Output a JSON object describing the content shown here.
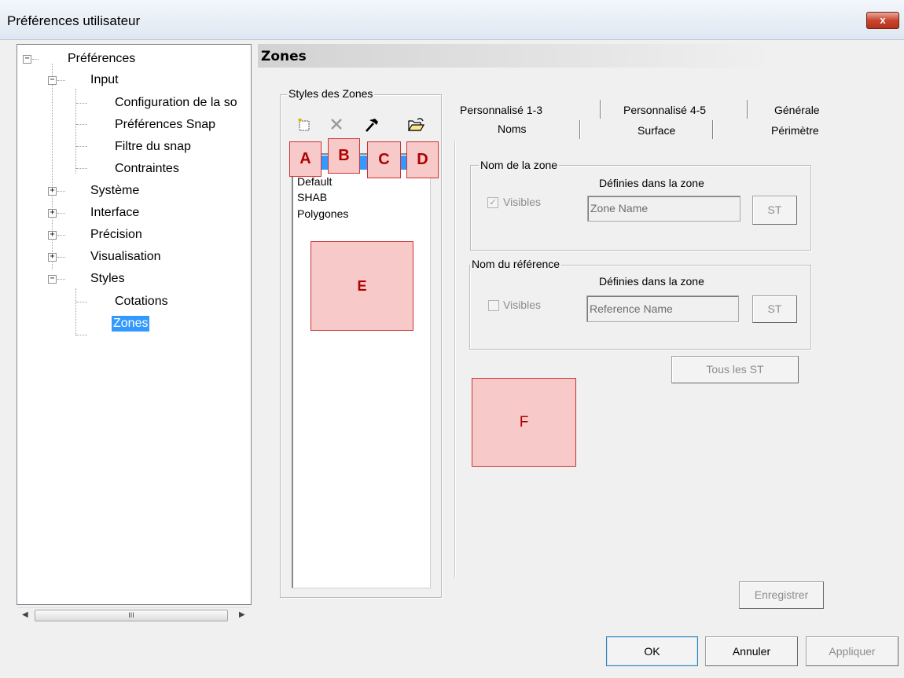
{
  "window": {
    "title": "Préférences utilisateur",
    "close_label": "x"
  },
  "tree": {
    "root": "Préférences",
    "input": "Input",
    "input_children": [
      "Configuration de la so",
      "Préférences Snap",
      "Filtre du snap",
      "Contraintes"
    ],
    "systeme": "Système",
    "interface": "Interface",
    "precision": "Précision",
    "visualisation": "Visualisation",
    "styles": "Styles",
    "styles_children": [
      "Cotations",
      "Zones"
    ],
    "scroll_thumb": "III"
  },
  "header": {
    "title": "Zones"
  },
  "styles_group": {
    "label": "Styles des Zones",
    "list_items": [
      "Default",
      "SHAB",
      "Polygones"
    ],
    "toolbar_icons": [
      "new-icon",
      "delete-icon",
      "hammer-icon",
      "open-folder-icon"
    ]
  },
  "markers": {
    "a": "A",
    "b": "B",
    "c": "C",
    "d": "D",
    "e": "E",
    "f": "F"
  },
  "tabs": {
    "row1": [
      "Personnalisé 1-3",
      "Personnalisé 4-5",
      "Générale"
    ],
    "row2": [
      "Noms",
      "Surface",
      "Périmètre"
    ],
    "active": "Noms"
  },
  "zone_name": {
    "group_label": "Nom de la zone",
    "caption": "Définies dans la zone",
    "visible_label": "Visibles",
    "visible_checked": true,
    "value": "Zone Name",
    "st_label": "ST"
  },
  "reference_name": {
    "group_label": "Nom du référence",
    "caption": "Définies dans la zone",
    "visible_label": "Visibles",
    "visible_checked": false,
    "value": "Reference Name",
    "st_label": "ST"
  },
  "buttons": {
    "all_st": "Tous les ST",
    "save": "Enregistrer",
    "ok": "OK",
    "cancel": "Annuler",
    "apply": "Appliquer"
  }
}
